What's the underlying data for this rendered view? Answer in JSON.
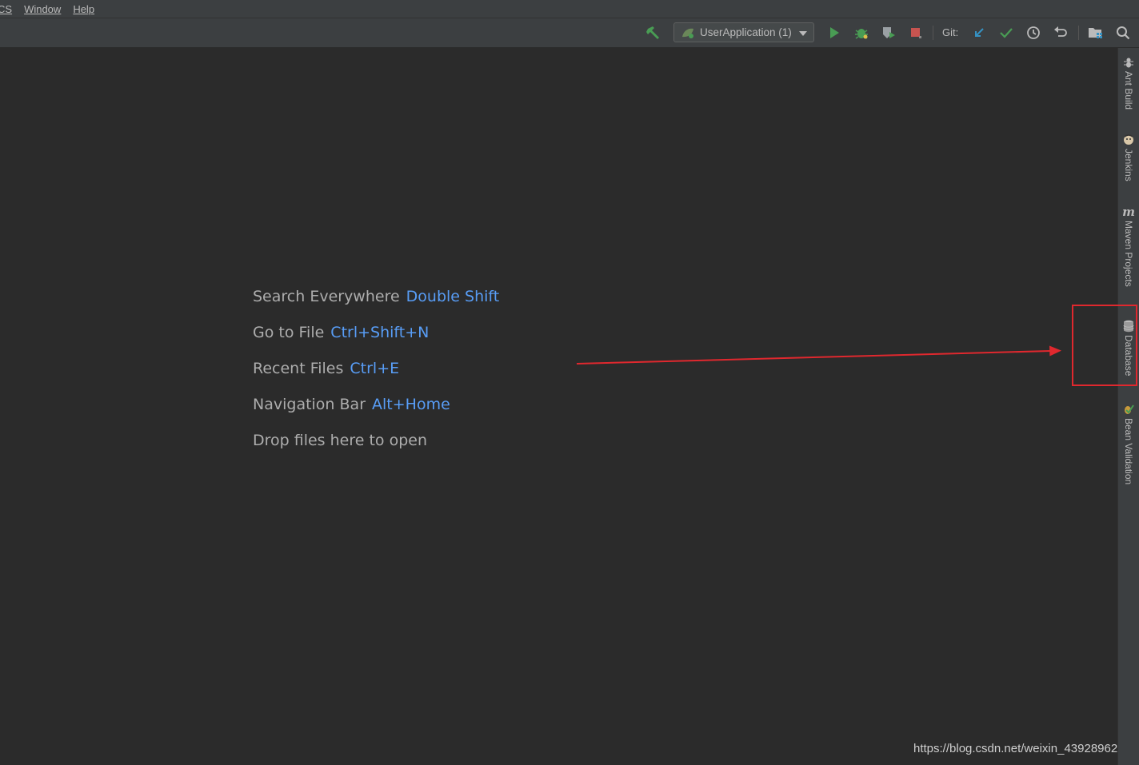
{
  "menubar": {
    "items": [
      "CS",
      "Window",
      "Help"
    ]
  },
  "toolbar": {
    "run_config_label": "UserApplication (1)",
    "git_label": "Git:"
  },
  "editor": {
    "hints": [
      {
        "label": "Search Everywhere",
        "key": "Double Shift"
      },
      {
        "label": "Go to File",
        "key": "Ctrl+Shift+N"
      },
      {
        "label": "Recent Files",
        "key": "Ctrl+E"
      },
      {
        "label": "Navigation Bar",
        "key": "Alt+Home"
      },
      {
        "label": "Drop files here to open",
        "key": ""
      }
    ]
  },
  "tool_windows": [
    {
      "label": "Ant Build",
      "icon": "ant-icon"
    },
    {
      "label": "Jenkins",
      "icon": "jenkins-icon"
    },
    {
      "label": "Maven Projects",
      "icon": "maven-icon"
    },
    {
      "label": "Database",
      "icon": "database-icon"
    },
    {
      "label": "Bean Validation",
      "icon": "bean-validation-icon"
    }
  ],
  "colors": {
    "accent_key": "#589df6",
    "annotation_red": "#e0282e",
    "run_green": "#499c54",
    "stop_red": "#c75450"
  },
  "watermark": "https://blog.csdn.net/weixin_43928962"
}
